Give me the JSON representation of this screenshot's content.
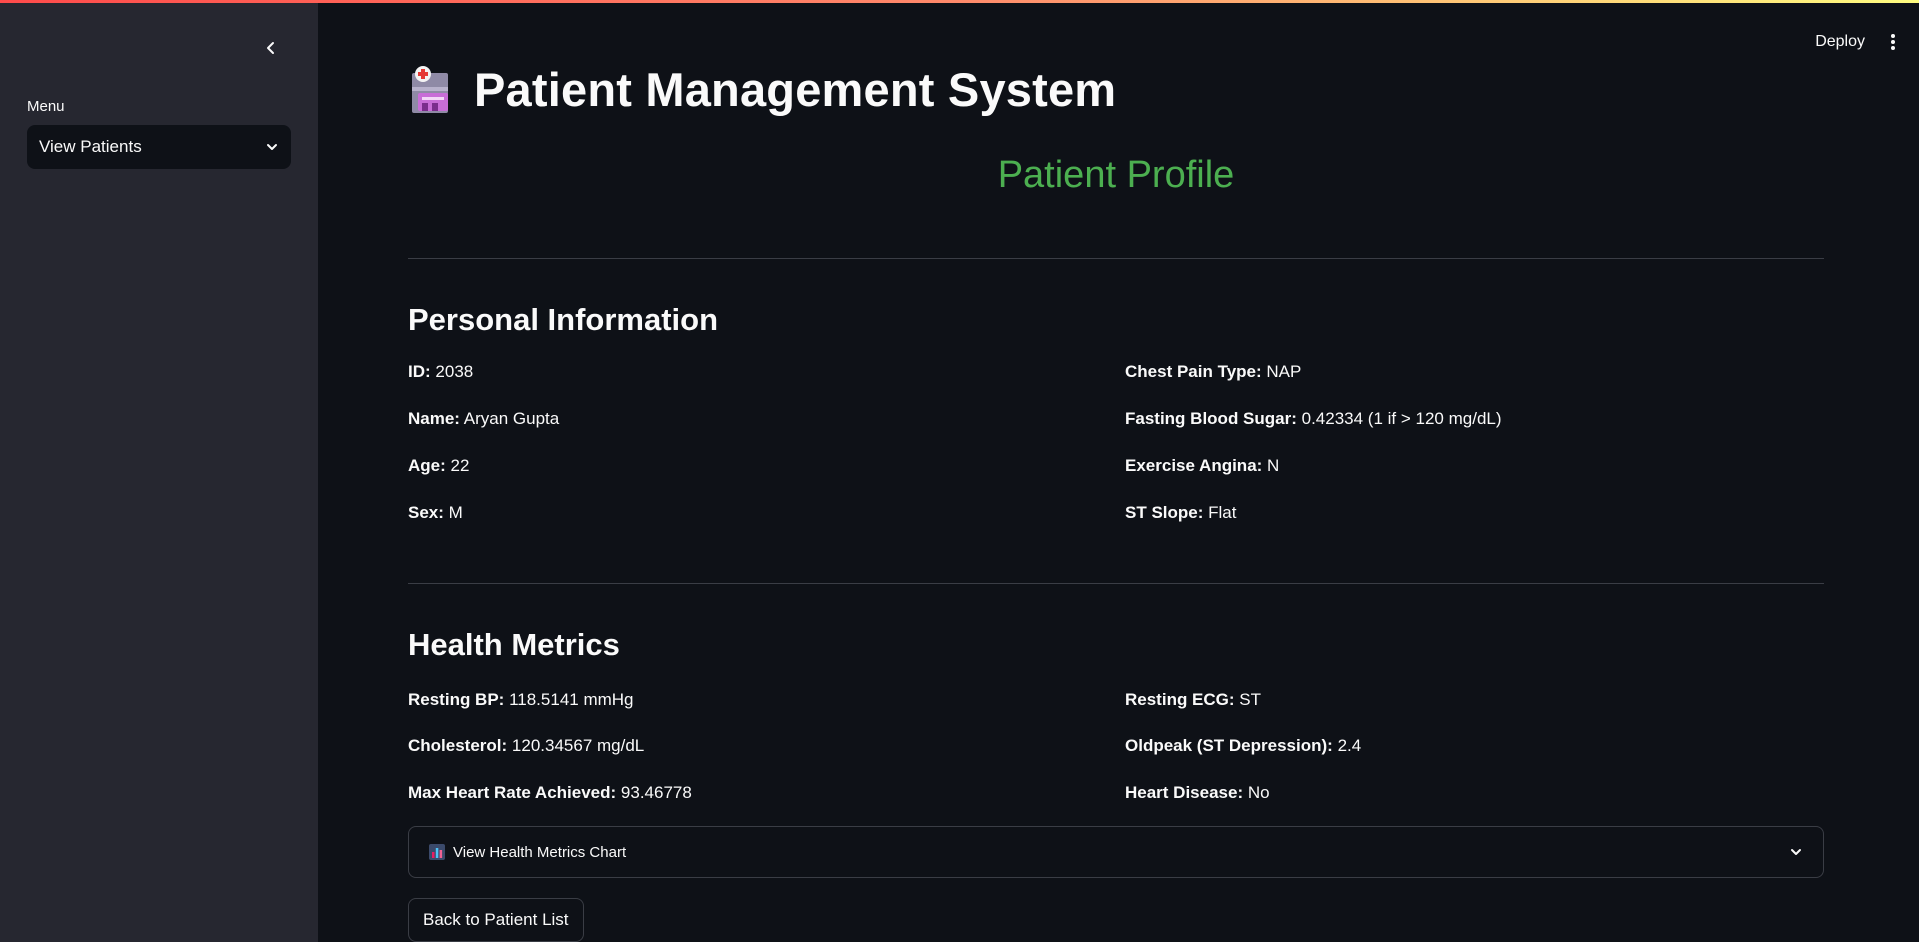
{
  "sidebar": {
    "menu_label": "Menu",
    "menu_selected": "View Patients"
  },
  "header": {
    "deploy_label": "Deploy"
  },
  "main": {
    "title": "Patient Management System",
    "profile_heading": "Patient Profile",
    "personal": {
      "title": "Personal Information",
      "left": [
        {
          "label": "ID:",
          "value": "2038"
        },
        {
          "label": "Name:",
          "value": "Aryan Gupta"
        },
        {
          "label": "Age:",
          "value": "22"
        },
        {
          "label": "Sex:",
          "value": "M"
        }
      ],
      "right": [
        {
          "label": "Chest Pain Type:",
          "value": "NAP"
        },
        {
          "label": "Fasting Blood Sugar:",
          "value": "0.42334 (1 if > 120 mg/dL)"
        },
        {
          "label": "Exercise Angina:",
          "value": "N"
        },
        {
          "label": "ST Slope:",
          "value": "Flat"
        }
      ]
    },
    "metrics": {
      "title": "Health Metrics",
      "left": [
        {
          "label": "Resting BP:",
          "value": "118.5141 mmHg"
        },
        {
          "label": "Cholesterol:",
          "value": "120.34567 mg/dL"
        },
        {
          "label": "Max Heart Rate Achieved:",
          "value": "93.46778"
        }
      ],
      "right": [
        {
          "label": "Resting ECG:",
          "value": "ST"
        },
        {
          "label": "Oldpeak (ST Depression):",
          "value": "2.4"
        },
        {
          "label": "Heart Disease:",
          "value": "No"
        }
      ]
    },
    "expander_label": "View Health Metrics Chart",
    "back_button": "Back to Patient List"
  },
  "colors": {
    "accent_green": "#4caf50",
    "background": "#0e1117",
    "sidebar": "#262730"
  },
  "icons": {
    "title": "hospital-icon",
    "expander": "bar-chart-icon"
  }
}
